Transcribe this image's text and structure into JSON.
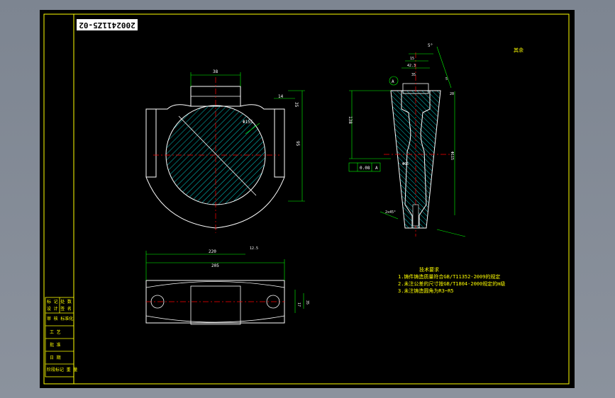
{
  "drawing": {
    "part_number": "2002411Z5-02",
    "colors": {
      "border": "#ffff00",
      "outline": "#ffffff",
      "centerline": "#ff0000",
      "dimension": "#00ff00",
      "hatch": "#00ffff",
      "background": "#000000"
    },
    "tech_notes": {
      "heading": "技术要求",
      "items": [
        "1.铸件铸造质量符合GB/T11352-2009的规定",
        "2.未注公差的尺寸按GB/T1804-2000规定的m级",
        "3.未注铸造圆角为R3~R5"
      ]
    },
    "roughness_note": "其余",
    "title_block": {
      "rows": [
        "标 记  处 数",
        "设 计  签 名",
        "审 核  标准化",
        "工 艺",
        "批 准",
        "日 期",
        "阶段标记  重 量"
      ]
    },
    "top_view_dims": [
      "38",
      "14",
      "35",
      "95",
      "Φ155"
    ],
    "section_view_dims": [
      "5°",
      "15",
      "42.3",
      "35",
      "138",
      "0.08",
      "A",
      "Φ65",
      "5",
      "20",
      "2x45°",
      "Φ115"
    ],
    "bottom_view_dims": [
      "220",
      "205",
      "12.5",
      "17",
      "35"
    ]
  }
}
